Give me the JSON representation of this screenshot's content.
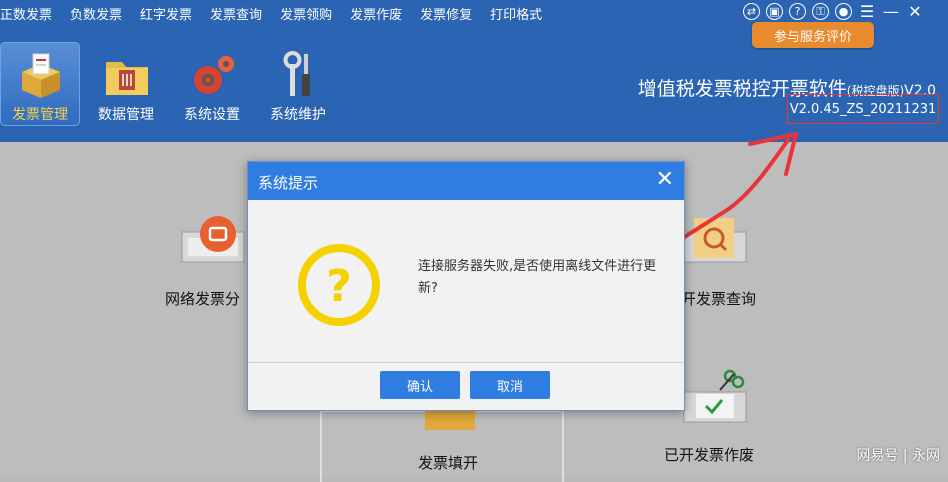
{
  "menu": [
    "正数发票",
    "负数发票",
    "红字发票",
    "发票查询",
    "发票领购",
    "发票作废",
    "发票修复",
    "打印格式"
  ],
  "window_controls": [
    {
      "icon": "exchange-icon",
      "glyph": "⇄"
    },
    {
      "icon": "tablet-icon",
      "glyph": "▣"
    },
    {
      "icon": "help-icon",
      "glyph": "?"
    },
    {
      "icon": "lock-icon",
      "glyph": "⚿"
    },
    {
      "icon": "user-icon",
      "glyph": "●"
    },
    {
      "icon": "menu-icon",
      "glyph": "☰"
    },
    {
      "icon": "minimize-icon",
      "glyph": "—"
    },
    {
      "icon": "close-icon",
      "glyph": "✕"
    }
  ],
  "feedback_button": "参与服务评价",
  "toolbar": [
    {
      "label": "发票管理",
      "icon": "invoice-box-icon",
      "active": true
    },
    {
      "label": "数据管理",
      "icon": "folder-icon",
      "active": false
    },
    {
      "label": "系统设置",
      "icon": "gears-icon",
      "active": false
    },
    {
      "label": "系统维护",
      "icon": "tools-icon",
      "active": false
    }
  ],
  "product": {
    "title": "增值税发票税控开票软件",
    "edition": "(税控盘版)",
    "suffix": "V2.0",
    "version": "V2.0.45_ZS_20211231"
  },
  "functions": {
    "network_dispatch": "网络发票分",
    "query_issued": "开发票查询",
    "fill_invoice": "发票填开",
    "void_issued": "已开发票作废"
  },
  "dialog": {
    "title": "系统提示",
    "message": "连接服务器失败,是否使用离线文件进行更新?",
    "icon": "question-icon",
    "confirm": "确认",
    "cancel": "取消"
  },
  "watermark": "网易号 | 永网",
  "colors": {
    "topbar": "#2b64b2",
    "dialog_title": "#2f7de0",
    "feedback": "#e88a2e",
    "highlight": "#e53935",
    "question": "#f5d100"
  }
}
